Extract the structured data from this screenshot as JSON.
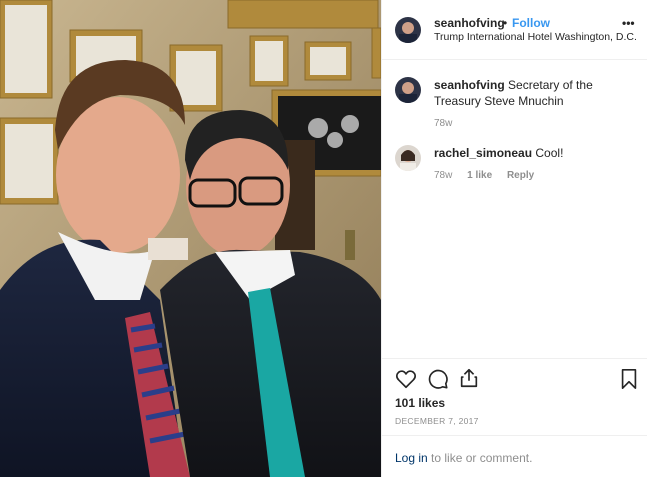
{
  "post": {
    "username": "seanhofving",
    "dot": "•",
    "follow_label": "Follow",
    "location": "Trump International Hotel Washington, D.C.",
    "more_label": "•••",
    "caption": {
      "username": "seanhofving",
      "text": "Secretary of the Treasury Steve Mnuchin",
      "time": "78w"
    },
    "comments": [
      {
        "username": "rachel_simoneau",
        "text": "Cool!",
        "time": "78w",
        "likes": "1 like",
        "reply_label": "Reply"
      }
    ],
    "likes_count": "101 likes",
    "date": "DECEMBER 7, 2017",
    "login_link": "Log in",
    "login_suffix": " to like or comment."
  },
  "icons": {
    "like": "heart-icon",
    "comment": "comment-bubble-icon",
    "share": "share-icon",
    "save": "bookmark-icon",
    "more": "more-options-icon"
  },
  "colors": {
    "accent": "#3897f0",
    "text": "#262626",
    "muted": "#8e8e8e",
    "link": "#003569",
    "divider": "#efefef"
  }
}
